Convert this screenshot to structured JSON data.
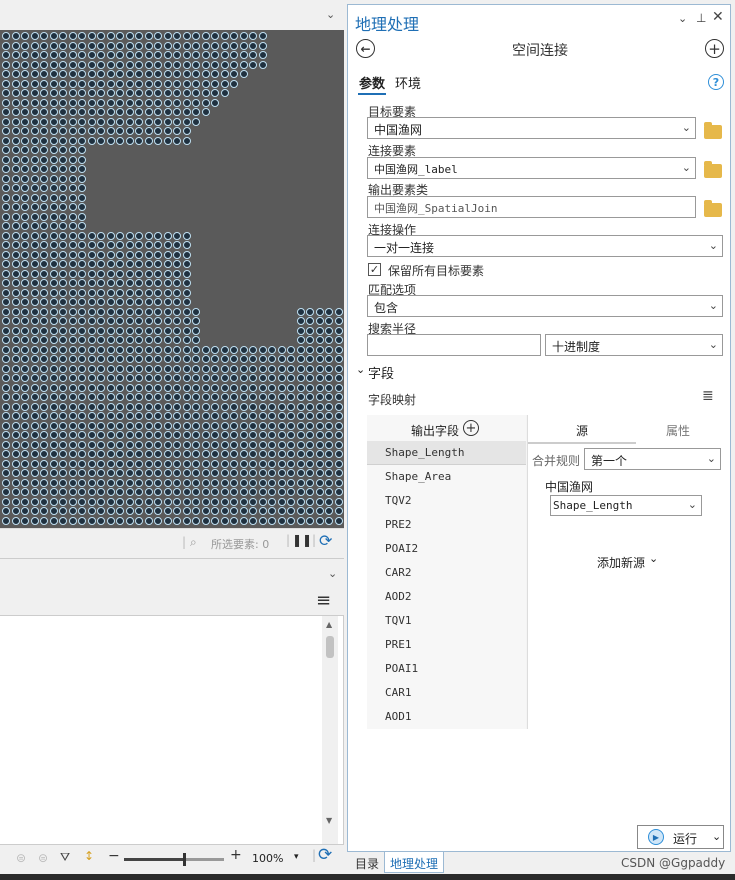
{
  "map": {
    "status_text": "所选要素: 0"
  },
  "table": {
    "zoom_value": "100%",
    "zoom_fill": 0.6
  },
  "pane": {
    "title": "地理处理",
    "tool_name": "空间连接",
    "tabs": [
      "参数",
      "环境"
    ],
    "target_label": "目标要素",
    "target_value": "中国渔网",
    "join_label": "连接要素",
    "join_value": "中国渔网_label",
    "output_label": "输出要素类",
    "output_value": "中国渔网_SpatialJoin",
    "operation_label": "连接操作",
    "operation_value": "一对一连接",
    "keep_all_label": "保留所有目标要素",
    "keep_all_checked": true,
    "match_label": "匹配选项",
    "match_value": "包含",
    "radius_label": "搜索半径",
    "radius_value": "",
    "radius_unit": "十进制度",
    "fields_section": "字段",
    "field_map_label": "字段映射",
    "output_fields_header": "输出字段",
    "source_tab": "源",
    "properties_tab": "属性",
    "output_fields": [
      "Shape_Length",
      "Shape_Area",
      "TQV2",
      "PRE2",
      "POAI2",
      "CAR2",
      "AOD2",
      "TQV1",
      "PRE1",
      "POAI1",
      "CAR1",
      "AOD1"
    ],
    "merge_rule_label": "合并规则",
    "merge_rule_value": "第一个",
    "source_name": "中国渔网",
    "source_field": "Shape_Length",
    "add_source": "添加新源",
    "run_label": "运行"
  },
  "bottom_tabs": [
    "目录",
    "地理处理"
  ],
  "watermark": "CSDN @Ggpaddy"
}
